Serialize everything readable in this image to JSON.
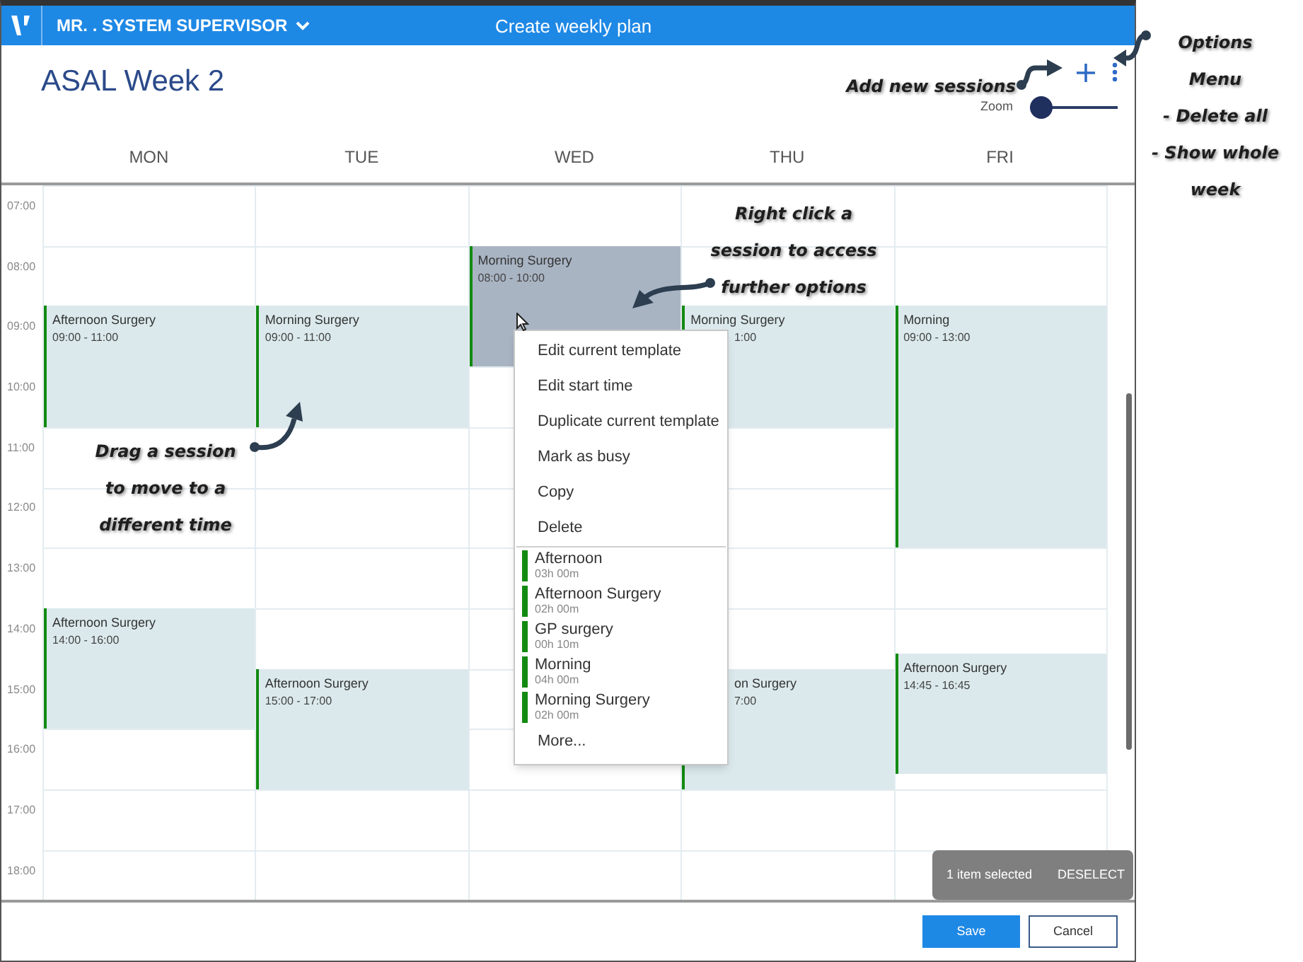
{
  "header": {
    "user": "MR. . SYSTEM SUPERVISOR",
    "title": "Create weekly plan"
  },
  "plan_title": "ASAL Week 2",
  "zoom": {
    "label": "Zoom",
    "level": 0
  },
  "hours": [
    "07:00",
    "08:00",
    "09:00",
    "10:00",
    "11:00",
    "12:00",
    "13:00",
    "14:00",
    "15:00",
    "16:00",
    "17:00",
    "18:00"
  ],
  "days": [
    {
      "label": "MON",
      "sessions": [
        {
          "title": "Afternoon Surgery",
          "time": "09:00 - 11:00",
          "selected": false
        },
        {
          "title": "Afternoon Surgery",
          "time": "14:00 - 16:00",
          "selected": false
        }
      ]
    },
    {
      "label": "TUE",
      "sessions": [
        {
          "title": "Morning Surgery",
          "time": "09:00 - 11:00",
          "selected": false
        },
        {
          "title": "Afternoon Surgery",
          "time": "15:00 - 17:00",
          "selected": false
        }
      ]
    },
    {
      "label": "WED",
      "sessions": [
        {
          "title": "Morning Surgery",
          "time": "08:00 - 10:00",
          "selected": true
        }
      ]
    },
    {
      "label": "THU",
      "sessions": [
        {
          "title": "Morning Surgery",
          "time": "1:00",
          "selected": false
        },
        {
          "title": "on Surgery",
          "time": "7:00",
          "selected": false
        }
      ]
    },
    {
      "label": "FRI",
      "sessions": [
        {
          "title": "Morning",
          "time": "09:00 - 13:00",
          "selected": false
        },
        {
          "title": "Afternoon Surgery",
          "time": "14:45 - 16:45",
          "selected": false
        }
      ]
    }
  ],
  "context_menu": {
    "actions": [
      "Edit current template",
      "Edit start time",
      "Duplicate current template",
      "Mark as busy",
      "Copy",
      "Delete"
    ],
    "templates": [
      {
        "name": "Afternoon",
        "duration": "03h 00m"
      },
      {
        "name": "Afternoon Surgery",
        "duration": "02h 00m"
      },
      {
        "name": "GP surgery",
        "duration": "00h 10m"
      },
      {
        "name": "Morning",
        "duration": "04h 00m"
      },
      {
        "name": "Morning Surgery",
        "duration": "02h 00m"
      }
    ],
    "more": "More..."
  },
  "snackbar": {
    "text": "1 item selected",
    "action": "DESELECT"
  },
  "buttons": [
    {
      "label": "Save",
      "kind": "primary"
    },
    {
      "label": "Cancel",
      "kind": "secondary"
    }
  ],
  "annotations": [
    {
      "lines": [
        "Add new sessions"
      ]
    },
    {
      "lines": [
        "Options",
        "Menu",
        "- Delete all",
        "- Show whole",
        "week"
      ]
    },
    {
      "lines": [
        "Right click a",
        "session to access",
        "further options"
      ]
    },
    {
      "lines": [
        "Drag a session",
        "to move to a",
        "different time"
      ]
    }
  ]
}
